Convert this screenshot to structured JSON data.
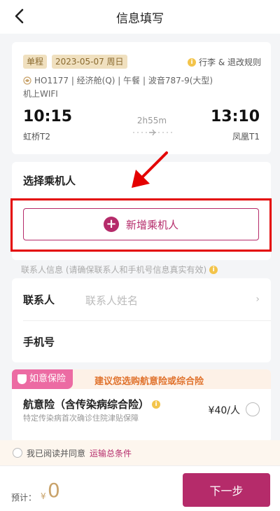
{
  "header": {
    "title": "信息填写",
    "back_icon": "chevron-left-icon"
  },
  "flight": {
    "trip_type": "单程",
    "date": "2023-05-07 周日",
    "rules_link": "行李 & 退改规则",
    "detail": "HO1177 | 经济舱(Q) | 午餐 | 波音787-9(大型)",
    "wifi": "机上WIFI",
    "depart_time": "10:15",
    "depart_terminal": "虹桥T2",
    "duration": "2h55m",
    "arrive_time": "13:10",
    "arrive_terminal": "凤凰T1"
  },
  "passenger": {
    "section_title": "选择乘机人",
    "add_button": "新增乘机人"
  },
  "contact": {
    "hint": "联系人信息 (请确保联系人和手机号信息真实有效)",
    "name_label": "联系人",
    "name_placeholder": "联系人姓名",
    "phone_label": "手机号"
  },
  "insurance": {
    "badge": "如意保险",
    "tip": "建议您选购航意险或综合险",
    "item_title": "航意险（含传染病综合险）",
    "item_sub": "特定传染病首次确诊住院津贴保障",
    "item_price": "¥40/人"
  },
  "agreement": {
    "text": "我已阅读并同意",
    "link": "运输总条件"
  },
  "footer": {
    "estimate_label": "预计：",
    "currency": "¥",
    "amount": "0",
    "next_button": "下一步"
  },
  "colors": {
    "accent": "#b52b6a",
    "annotation": "#e40000",
    "gold": "#c9a36b"
  }
}
